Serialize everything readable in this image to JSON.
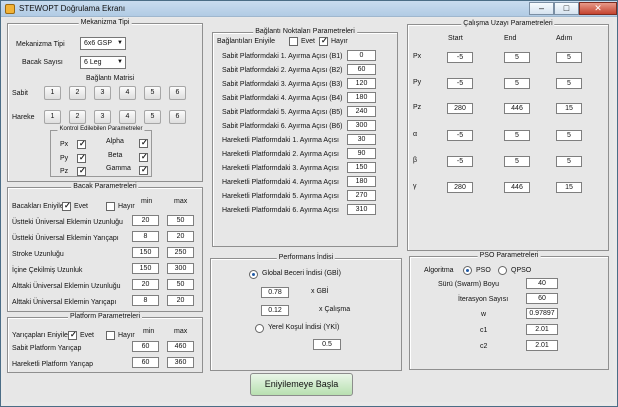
{
  "window": {
    "title": "STEWOPT Doğrulama Ekranı",
    "minimize": "–",
    "maximize": "□",
    "close": "✕"
  },
  "mechanism": {
    "title": "Mekanizma Tipi",
    "type_label": "Mekanizma Tipi",
    "type_value": "6x6 GSP",
    "leg_label": "Bacak Sayısı",
    "leg_value": "6 Leg",
    "matrix_title": "Bağlantı Matrisi",
    "sabit": "Sabit",
    "hareke": "Hareke",
    "numbers": [
      "1",
      "2",
      "3",
      "4",
      "5",
      "6"
    ],
    "controlled_title": "Kontrol Edilebilen Parametreler",
    "params": [
      "Px",
      "Alpha",
      "Py",
      "Beta",
      "Pz",
      "Gamma"
    ]
  },
  "legs": {
    "title": "Bacak Parametreleri",
    "label": "Bacakları Eniyile",
    "yes": "Evet",
    "no": "Hayır",
    "min": "min",
    "max": "max",
    "rows": [
      {
        "label": "Üstteki Üniversal Eklemin Uzunluğu",
        "min": "20",
        "max": "50"
      },
      {
        "label": "Üstteki Üniversal Eklemin Yarıçapı",
        "min": "8",
        "max": "20"
      },
      {
        "label": "Stroke Uzunluğu",
        "min": "150",
        "max": "250"
      },
      {
        "label": "İçine Çekilmiş Uzunluk",
        "min": "150",
        "max": "300"
      },
      {
        "label": "Alttaki Üniversal Eklemin Uzunluğu",
        "min": "20",
        "max": "50"
      },
      {
        "label": "Alttaki Üniversal Eklemin Yarıçapı",
        "min": "8",
        "max": "20"
      }
    ]
  },
  "platform": {
    "title": "Platform Parametreleri",
    "label": "Yarıçapları Eniyile",
    "yes": "Evet",
    "no": "Hayır",
    "min": "min",
    "max": "max",
    "rows": [
      {
        "label": "Sabit Platform Yarıçap",
        "min": "60",
        "max": "460"
      },
      {
        "label": "Hareketli Platform Yarıçap",
        "min": "60",
        "max": "360"
      }
    ]
  },
  "connection": {
    "title": "Bağlantı Noktaları Parametreleri",
    "label": "Bağlantıları Eniyile",
    "yes": "Evet",
    "no": "Hayır",
    "rows": [
      {
        "label": "Sabit Platformdaki 1. Ayırma Açısı (B1)",
        "value": "0"
      },
      {
        "label": "Sabit Platformdaki 2. Ayırma Açısı (B2)",
        "value": "60"
      },
      {
        "label": "Sabit Platformdaki 3. Ayırma Açısı (B3)",
        "value": "120"
      },
      {
        "label": "Sabit Platformdaki 4. Ayırma Açısı (B4)",
        "value": "180"
      },
      {
        "label": "Sabit Platformdaki 5. Ayırma Açısı (B5)",
        "value": "240"
      },
      {
        "label": "Sabit Platformdaki 6. Ayırma Açısı (B6)",
        "value": "300"
      },
      {
        "label": "Hareketli Platformdaki 1. Ayırma Açısı",
        "value": "30"
      },
      {
        "label": "Hareketli Platformdaki 2. Ayırma Açısı",
        "value": "90"
      },
      {
        "label": "Hareketli Platformdaki 3. Ayırma Açısı",
        "value": "150"
      },
      {
        "label": "Hareketli Platformdaki 4. Ayırma Açısı",
        "value": "180"
      },
      {
        "label": "Hareketli Platformdaki 5. Ayırma Açısı",
        "value": "270"
      },
      {
        "label": "Hareketli Platformdaki 6. Ayırma Açısı",
        "value": "310"
      }
    ]
  },
  "workspace": {
    "title": "Çalışma Uzayı Parametreleri",
    "start": "Start",
    "end": "End",
    "step": "Adım",
    "rows": [
      {
        "label": "Px",
        "start": "-5",
        "end": "5",
        "step": "5"
      },
      {
        "label": "Py",
        "start": "-5",
        "end": "5",
        "step": "5"
      },
      {
        "label": "Pz",
        "start": "280",
        "end": "446",
        "step": "15"
      },
      {
        "label": "α",
        "start": "-5",
        "end": "5",
        "step": "5"
      },
      {
        "label": "β",
        "start": "-5",
        "end": "5",
        "step": "5"
      },
      {
        "label": "γ",
        "start": "280",
        "end": "446",
        "step": "15"
      }
    ]
  },
  "performance": {
    "title": "Performans İndisi",
    "global": "Global Beceri İndisi (GBİ)",
    "gbi_value": "0.78",
    "gbi_label": "x  GBİ",
    "work_value": "0.12",
    "work_label": "x  Çalışma",
    "local": "Yerel Koşul İndisi (YKİ)",
    "local_value": "0.5"
  },
  "pso": {
    "title": "PSO Parametreleri",
    "algorithm": "Algoritma",
    "pso": "PSO",
    "qpso": "QPSO",
    "rows": [
      {
        "label": "Sürü (Swarm) Boyu",
        "value": "40"
      },
      {
        "label": "İterasyon Sayısı",
        "value": "60"
      },
      {
        "label": "w",
        "value": "0.97897"
      },
      {
        "label": "c1",
        "value": "2.01"
      },
      {
        "label": "c2",
        "value": "2.01"
      }
    ]
  },
  "actions": {
    "optimize": "Eniyilemeye Başla"
  }
}
